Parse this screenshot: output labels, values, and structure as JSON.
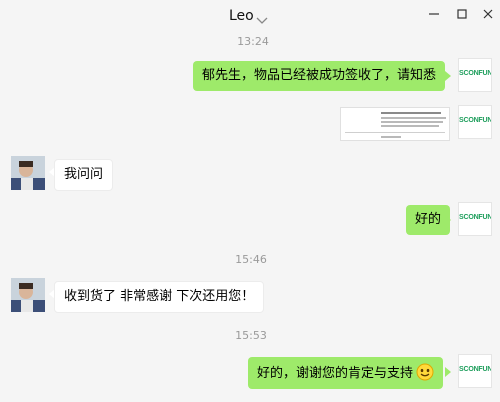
{
  "window": {
    "contact_name": "Leo",
    "controls": [
      "minimize-icon",
      "maximize-icon",
      "close-icon"
    ]
  },
  "brand": {
    "avatar_text": "SCONFUN",
    "color": "#1e9e5c"
  },
  "colors": {
    "my_bubble": "#9eea6a",
    "their_bubble": "#ffffff",
    "background": "#f5f5f5",
    "timestamp": "#9a9a9a"
  },
  "messages": {
    "t1": "13:24",
    "m1": "郁先生，物品已经被成功签收了，请知悉",
    "m3": "我问问",
    "m4": "好的",
    "t2": "15:46",
    "m5": "收到货了 非常感谢 下次还用您！",
    "t3": "15:53",
    "m6": "好的，谢谢您的肯定与支持"
  },
  "image_message": {
    "icon": "receipt-image-thumbnail"
  },
  "emoji": "smile-emoji"
}
